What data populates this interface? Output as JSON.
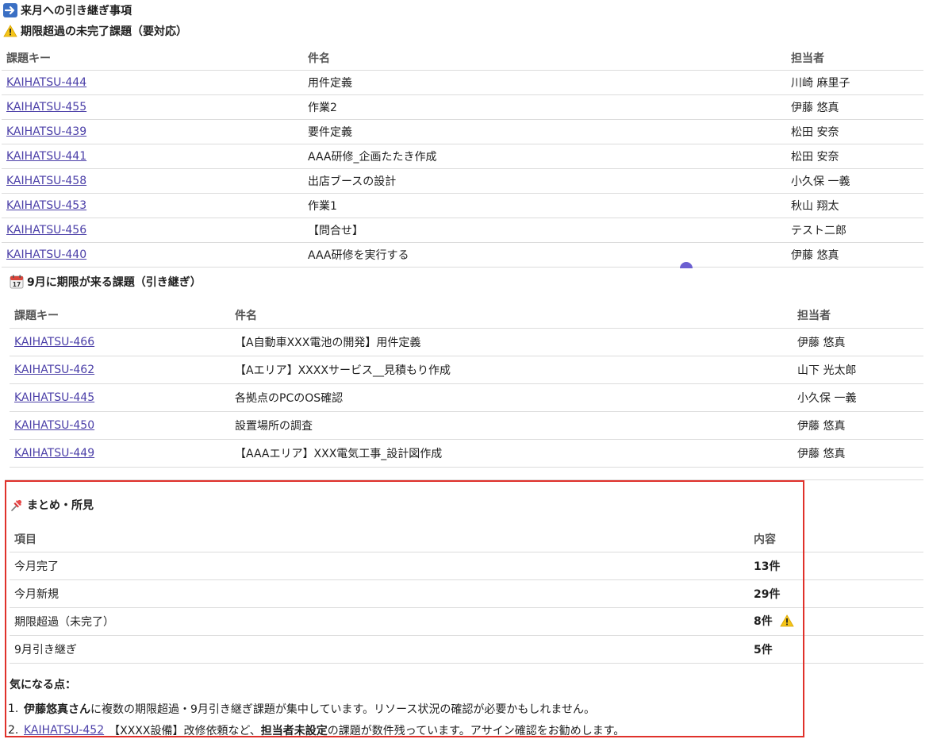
{
  "header": {
    "title": "来月への引き継ぎ事項"
  },
  "overdue": {
    "title": "期限超過の未完了課題（要対応）",
    "columns": [
      "課題キー",
      "件名",
      "担当者"
    ],
    "rows": [
      {
        "key": "KAIHATSU-444",
        "subject": "用件定義",
        "assignee": "川崎 麻里子"
      },
      {
        "key": "KAIHATSU-455",
        "subject": "作業2",
        "assignee": "伊藤 悠真"
      },
      {
        "key": "KAIHATSU-439",
        "subject": "要件定義",
        "assignee": "松田 安奈"
      },
      {
        "key": "KAIHATSU-441",
        "subject": "AAA研修_企画たたき作成",
        "assignee": "松田 安奈"
      },
      {
        "key": "KAIHATSU-458",
        "subject": "出店ブースの設計",
        "assignee": "小久保 一義"
      },
      {
        "key": "KAIHATSU-453",
        "subject": "作業1",
        "assignee": "秋山 翔太"
      },
      {
        "key": "KAIHATSU-456",
        "subject": "【問合せ】",
        "assignee": "テスト二郎"
      },
      {
        "key": "KAIHATSU-440",
        "subject": "AAA研修を実行する",
        "assignee": "伊藤 悠真"
      }
    ]
  },
  "september": {
    "title": "9月に期限が来る課題（引き継ぎ）",
    "columns": [
      "課題キー",
      "件名",
      "担当者"
    ],
    "rows": [
      {
        "key": "KAIHATSU-466",
        "subject": "【A自動車XXX電池の開発】用件定義",
        "assignee": "伊藤 悠真"
      },
      {
        "key": "KAIHATSU-462",
        "subject": "【Aエリア】XXXXサービス__見積もり作成",
        "assignee": "山下 光太郎"
      },
      {
        "key": "KAIHATSU-445",
        "subject": "各拠点のPCのOS確認",
        "assignee": "小久保 一義"
      },
      {
        "key": "KAIHATSU-450",
        "subject": "設置場所の調査",
        "assignee": "伊藤 悠真"
      },
      {
        "key": "KAIHATSU-449",
        "subject": "【AAAエリア】XXX電気工事_設計図作成",
        "assignee": "伊藤 悠真"
      }
    ]
  },
  "summary": {
    "title": "まとめ・所見",
    "columns": [
      "項目",
      "内容"
    ],
    "rows": [
      {
        "item": "今月完了",
        "value": "13件"
      },
      {
        "item": "今月新規",
        "value": "29件"
      },
      {
        "item": "期限超過（未完了）",
        "value": "8件"
      },
      {
        "item": "9月引き継ぎ",
        "value": "5件"
      }
    ],
    "notes_title": "気になる点：",
    "note1": {
      "num": "1.",
      "bold": "伊藤悠真さん",
      "text": "に複数の期限超過・9月引き継ぎ課題が集中しています。リソース状況の確認が必要かもしれません。"
    },
    "note2": {
      "num": "2.",
      "link": "KAIHATSU-452",
      "text1": "【XXXX設備】改修依頼など、",
      "bold": "担当者未設定",
      "text2": "の課題が数件残っています。アサイン確認をお勧めします。"
    }
  },
  "colors": {
    "link": "#4b3fa8",
    "highlight_border": "#e0312b",
    "warning": "#f5c518"
  }
}
